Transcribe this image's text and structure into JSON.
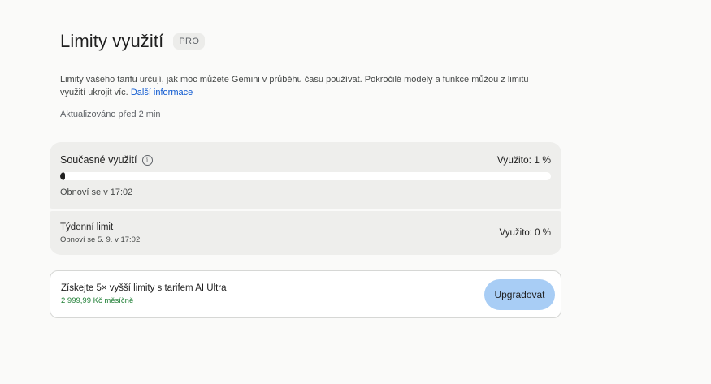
{
  "header": {
    "title": "Limity využití",
    "badge": "PRO"
  },
  "intro": {
    "description": "Limity vašeho tarifu určují, jak moc můžete Gemini v průběhu času používat. Pokročilé modely a funkce můžou z limitu využití ukrojit víc.",
    "learn_more": "Další informace",
    "updated": "Aktualizováno před 2 min"
  },
  "current_usage": {
    "label": "Současné využití",
    "info_icon": "info-icon",
    "usage_text": "Využito: 1 %",
    "progress_percent": 1,
    "reset_text": "Obnoví se v 17:02"
  },
  "weekly_limit": {
    "label": "Týdenní limit",
    "reset_text": "Obnoví se 5. 9. v 17:02",
    "usage_text": "Využito: 0 %",
    "progress_percent": 0
  },
  "upgrade": {
    "title": "Získejte 5× vyšší limity s tarifem AI Ultra",
    "price": "2 999,99 Kč měsíčně",
    "button_label": "Upgradovat"
  },
  "colors": {
    "background": "#fafaf9",
    "card": "#eeeeec",
    "link": "#0b57d0",
    "price": "#1e7e34",
    "button": "#a8cdf5",
    "progress_fill": "#1f1f1f"
  }
}
